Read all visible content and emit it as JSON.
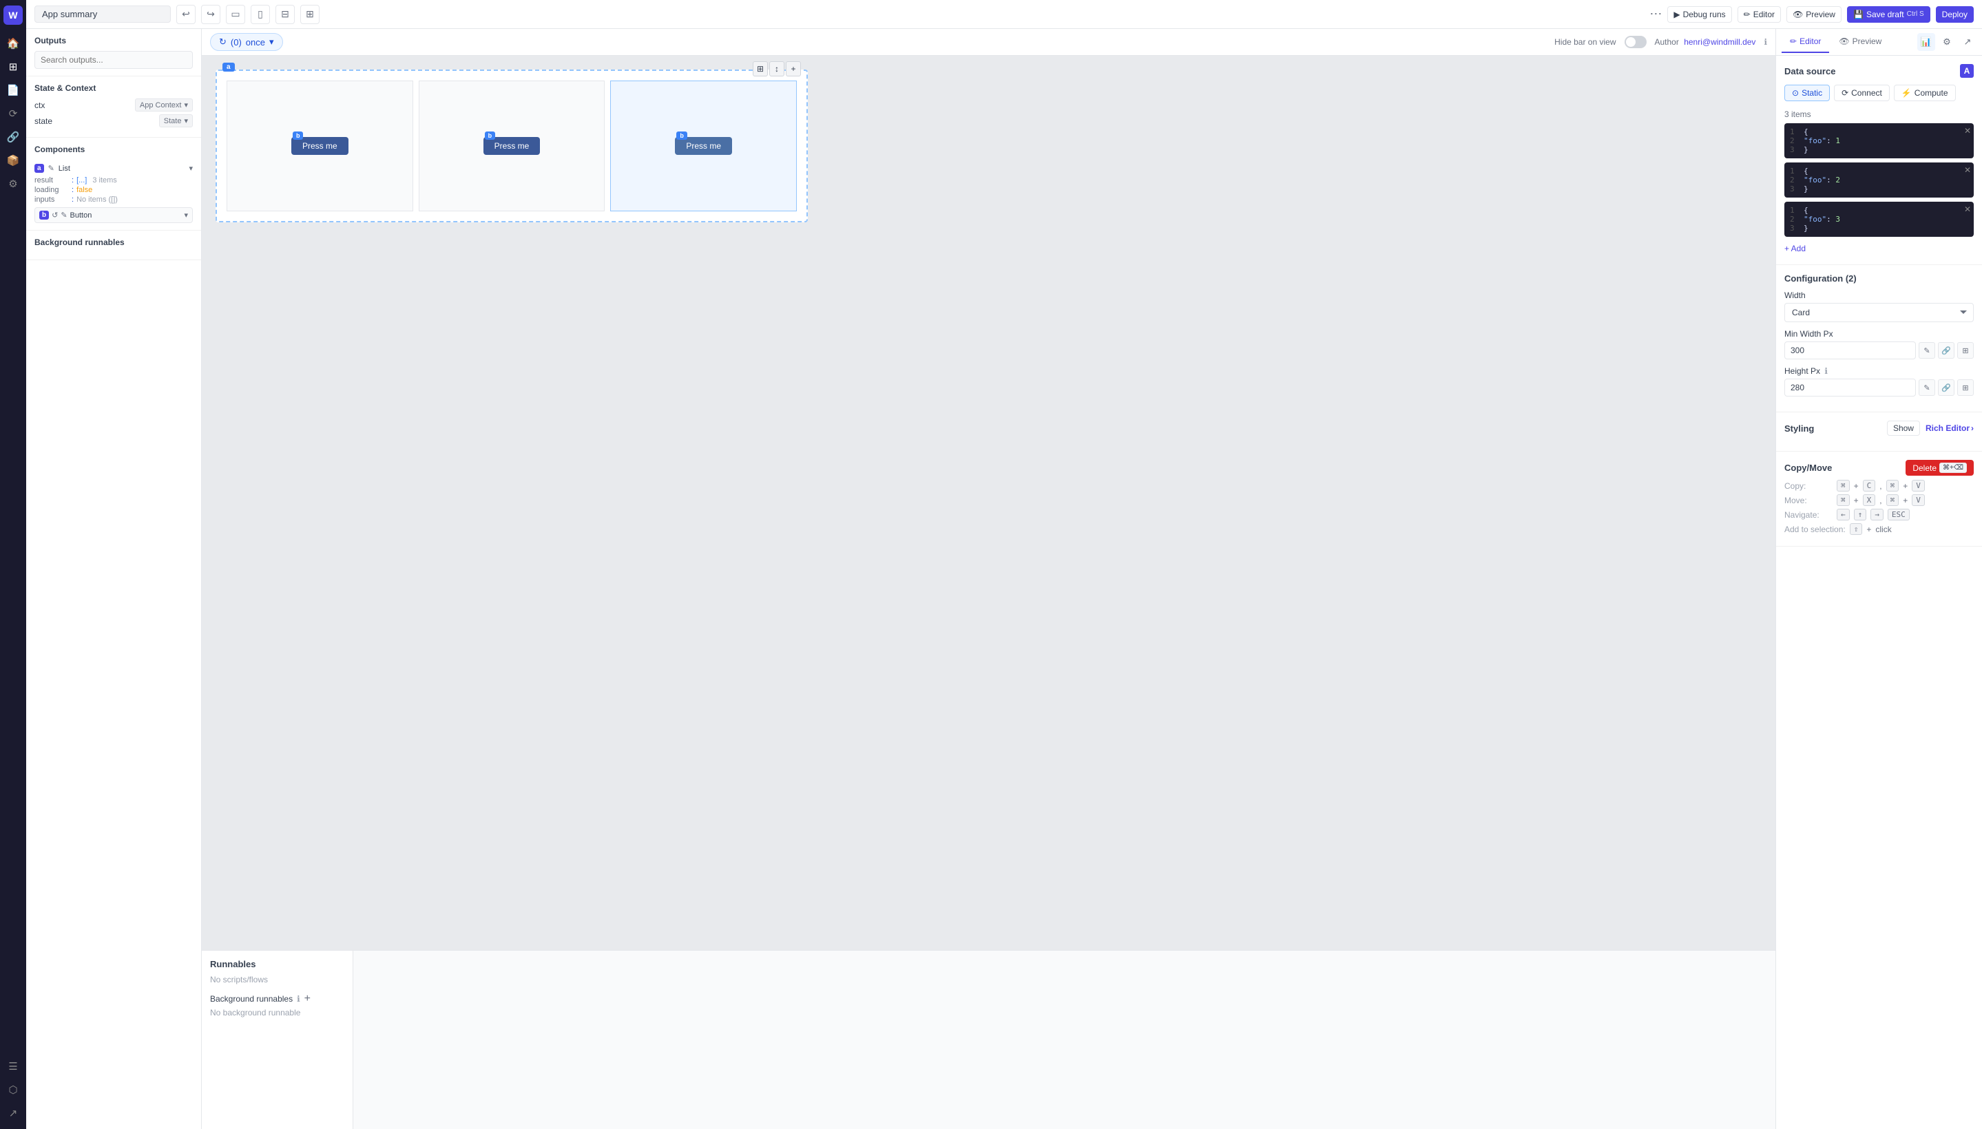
{
  "app": {
    "title": "App summary"
  },
  "topbar": {
    "undo_icon": "↩",
    "redo_icon": "↪",
    "layout_icon_1": "▭",
    "layout_icon_2": "▯",
    "layout_icon_3": "⊟",
    "layout_icon_4": "⊞",
    "more_icon": "⋯",
    "debug_runs_label": "Debug runs",
    "editor_label": "Editor",
    "preview_label": "Preview",
    "save_draft_label": "Save draft",
    "save_draft_shortcut": "Ctrl S",
    "deploy_label": "Deploy"
  },
  "canvas": {
    "runs_count": "(0)",
    "frequency_label": "once",
    "hide_bar_label": "Hide bar on view",
    "author_label": "Author",
    "author_email": "henri@windmill.dev"
  },
  "left_panel": {
    "outputs_title": "Outputs",
    "search_placeholder": "Search outputs...",
    "state_context_title": "State & Context",
    "ctx_label": "ctx",
    "ctx_badge": "App Context",
    "state_label": "state",
    "state_badge": "State",
    "components_title": "Components",
    "list_badge": "List",
    "component_a_label": "a",
    "result_label": "result",
    "result_value": "[...]",
    "result_count": "3 items",
    "loading_label": "loading",
    "loading_value": "false",
    "inputs_label": "inputs",
    "inputs_value": "No items ([])",
    "sub_component_badge": "b",
    "sub_component_label": "Button",
    "background_runnables_title": "Background runnables"
  },
  "bottom_panel": {
    "runnables_title": "Runnables",
    "no_scripts": "No scripts/flows",
    "bg_runnables_title": "Background runnables",
    "no_bg_runnable": "No background runnable"
  },
  "right_panel": {
    "editor_tab": "Editor",
    "preview_tab": "Preview",
    "data_source_title": "Data source",
    "static_tab": "Static",
    "connect_tab": "Connect",
    "compute_tab": "Compute",
    "items_count": "3 items",
    "code_blocks": [
      {
        "lines": [
          {
            "ln": "1",
            "content": "{"
          },
          {
            "ln": "2",
            "content": "\"foo\": 1"
          },
          {
            "ln": "3",
            "content": "}"
          }
        ]
      },
      {
        "lines": [
          {
            "ln": "1",
            "content": "{"
          },
          {
            "ln": "2",
            "content": "\"foo\": 2"
          },
          {
            "ln": "3",
            "content": "}"
          }
        ]
      },
      {
        "lines": [
          {
            "ln": "1",
            "content": "{"
          },
          {
            "ln": "2",
            "content": "\"foo\": 3"
          },
          {
            "ln": "3",
            "content": "}"
          }
        ]
      }
    ],
    "add_label": "+ Add",
    "configuration_title": "Configuration (2)",
    "width_label": "Width",
    "width_value": "Card",
    "min_width_label": "Min Width Px",
    "min_width_value": "300",
    "height_label": "Height Px",
    "height_value": "280",
    "styling_title": "Styling",
    "show_label": "Show",
    "rich_editor_label": "Rich Editor",
    "copy_move_title": "Copy/Move",
    "delete_label": "Delete",
    "delete_shortcut": "⌘+⌫",
    "copy_label": "Copy:",
    "copy_shortcut_1": "⌘ + C",
    "copy_shortcut_2": "⌘ + V",
    "move_label": "Move:",
    "move_shortcut_1": "⌘ + X",
    "move_shortcut_2": "⌘ + V",
    "navigate_label": "Navigate:",
    "navigate_shortcuts": "← ↑ → ESC",
    "add_to_selection_label": "Add to selection:",
    "add_to_selection_shortcut": "⇧ + click"
  },
  "cards": [
    {
      "id": 1,
      "label": "Press me"
    },
    {
      "id": 2,
      "label": "Press me"
    },
    {
      "id": 3,
      "label": "Press me"
    }
  ]
}
